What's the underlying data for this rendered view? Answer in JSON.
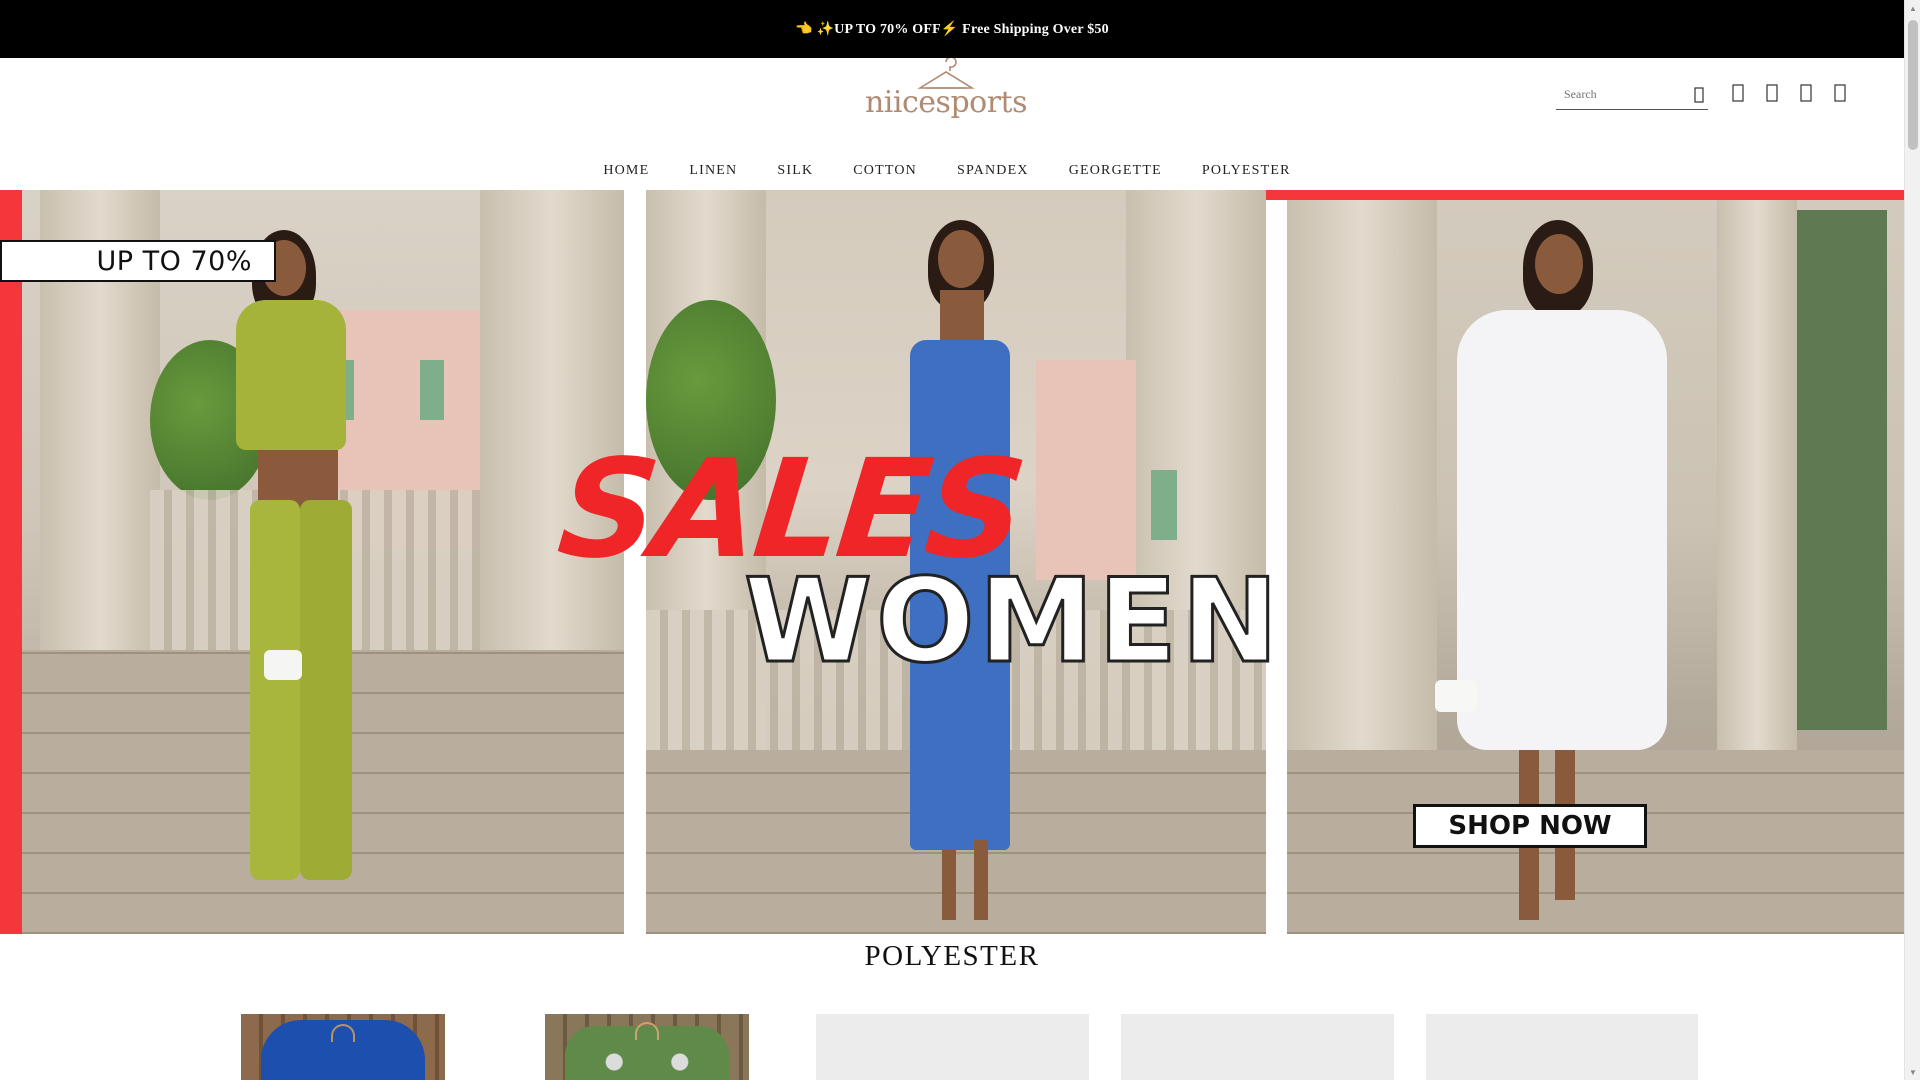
{
  "announcement": {
    "text": "👈 ✨UP TO 70% OFF⚡ Free Shipping Over $50"
  },
  "header": {
    "logo_text": "niicesports",
    "search_placeholder": "Search",
    "icons": [
      "search-icon",
      "account-icon",
      "wishlist-icon",
      "compare-icon",
      "cart-icon"
    ]
  },
  "nav": {
    "items": [
      {
        "label": "HOME"
      },
      {
        "label": "LINEN"
      },
      {
        "label": "SILK"
      },
      {
        "label": "COTTON"
      },
      {
        "label": "SPANDEX"
      },
      {
        "label": "GEORGETTE"
      },
      {
        "label": "POLYESTER"
      }
    ]
  },
  "banner": {
    "badge": "UP TO 70%",
    "headline_1": "SALES",
    "headline_2": "WOMEN",
    "cta": "SHOP NOW",
    "accent_color": "#f4373a"
  },
  "section": {
    "title": "POLYESTER"
  }
}
